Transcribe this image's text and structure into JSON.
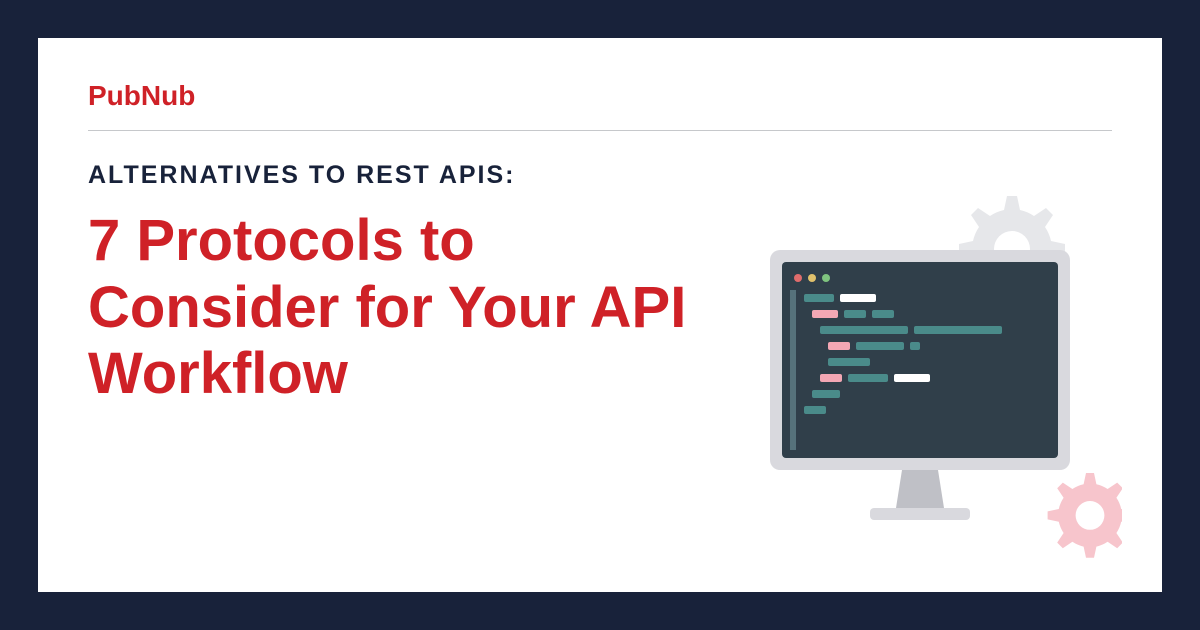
{
  "brand": "PubNub",
  "subtitle": "ALTERNATIVES TO REST APIS:",
  "title": "7 Protocols to Consider for Your API Workflow",
  "colors": {
    "background": "#18223a",
    "card": "#ffffff",
    "accent": "#cf2127",
    "subtitle": "#18223a",
    "monitor_screen": "#303f4a",
    "monitor_bezel": "#d9d9de",
    "code_teal": "#4a8b8a",
    "code_pink": "#f3a7b4",
    "code_white": "#ffffff",
    "gear_grey": "#e6e7ea",
    "gear_pink": "#f7c5cc"
  }
}
